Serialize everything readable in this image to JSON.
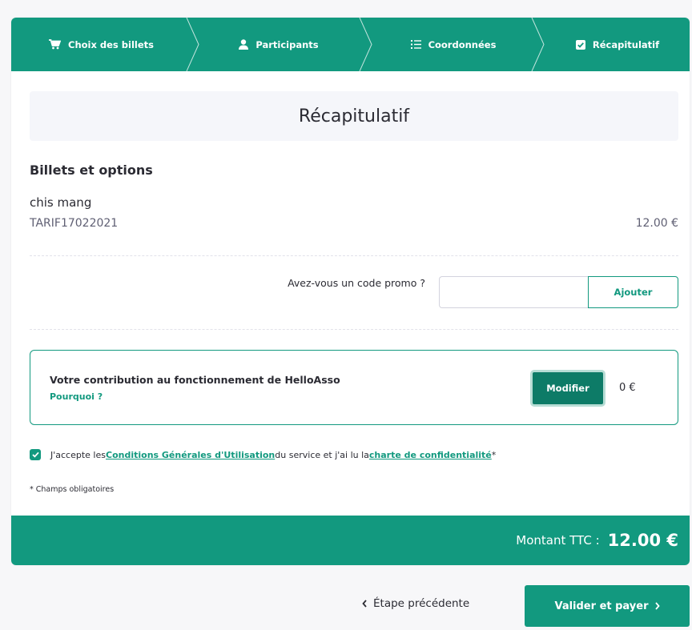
{
  "steps": [
    {
      "label": "Choix des billets",
      "icon": "cart-icon"
    },
    {
      "label": "Participants",
      "icon": "user-icon"
    },
    {
      "label": "Coordonnées",
      "icon": "list-icon"
    },
    {
      "label": "Récapitulatif",
      "icon": "checkbox-icon"
    }
  ],
  "page_title": "Récapitulatif",
  "tickets": {
    "heading": "Billets et options",
    "items": [
      {
        "name": "chis mang",
        "tariff": "TARIF17022021",
        "price": "12.00 €"
      }
    ]
  },
  "promo": {
    "label": "Avez-vous un code promo ?",
    "value": "",
    "button": "Ajouter"
  },
  "contribution": {
    "title": "Votre contribution au fonctionnement de HelloAsso",
    "link": "Pourquoi ?",
    "button": "Modifier",
    "amount": "0 €"
  },
  "terms": {
    "text1": "J'accepte les ",
    "link1": "Conditions Générales d'Utilisation",
    "text2": " du service et j'ai lu la ",
    "link2": "charte de confidentialité",
    "text3": " *",
    "checked": true
  },
  "required_note": "* Champs obligatoires",
  "total": {
    "label": "Montant TTC :",
    "value": "12.00 €"
  },
  "nav": {
    "prev": "Étape précédente",
    "next": "Valider et payer"
  },
  "colors": {
    "brand": "#12997f",
    "brand_dark": "#0d7b67"
  }
}
